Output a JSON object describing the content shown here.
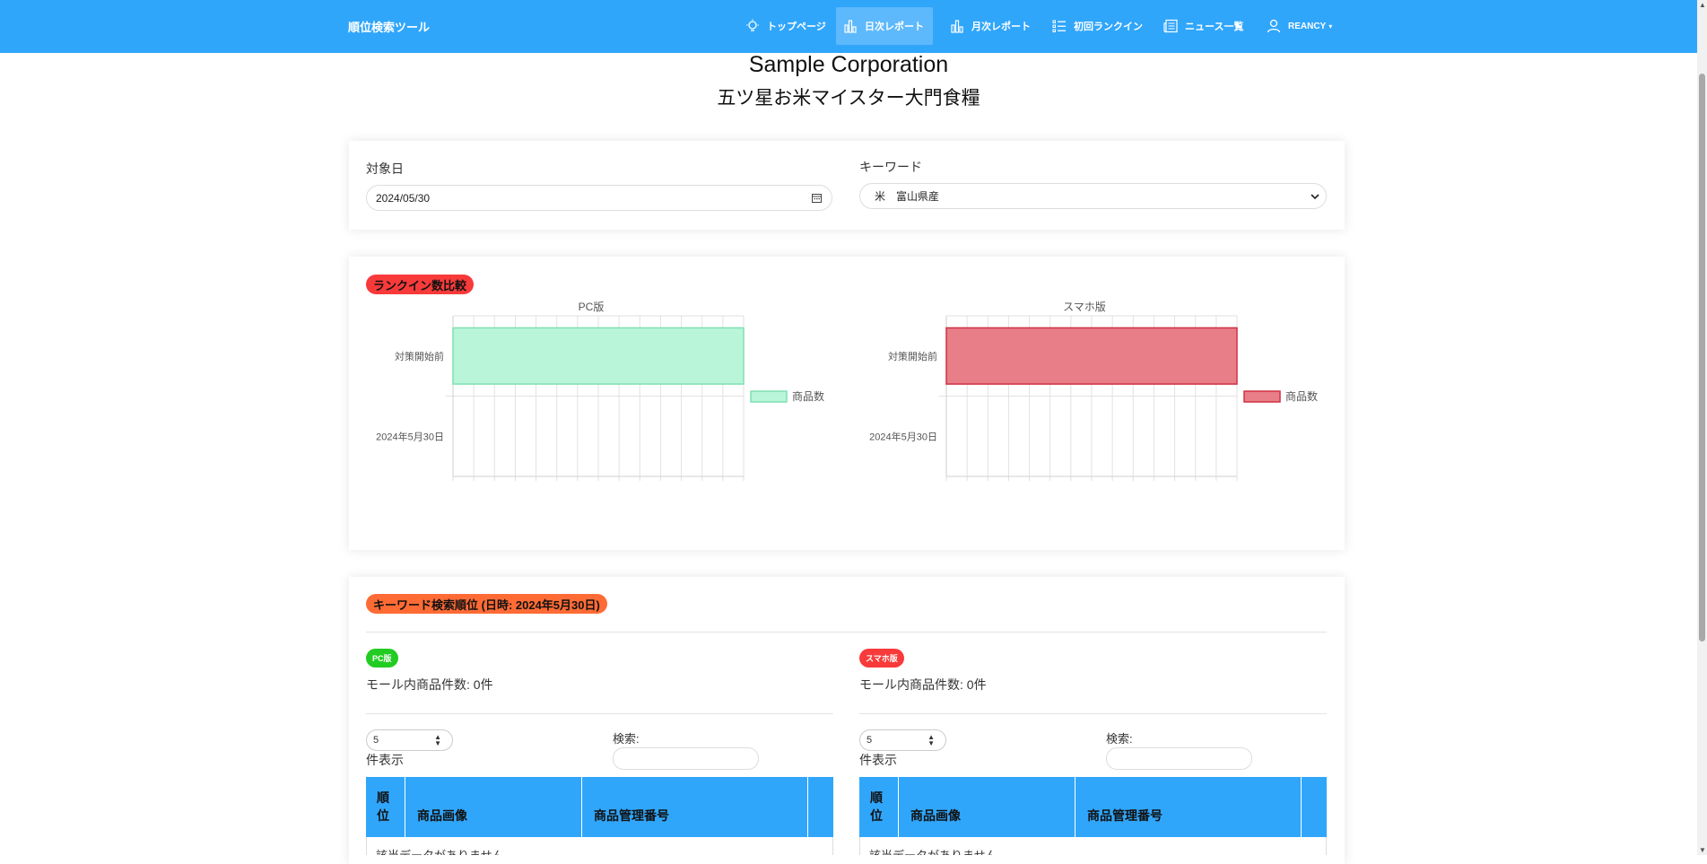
{
  "nav": {
    "brand": "順位検索ツール",
    "items": [
      {
        "label": "トップページ",
        "icon": "lightbulb-icon"
      },
      {
        "label": "日次レポート",
        "icon": "bar-chart-icon"
      },
      {
        "label": "月次レポート",
        "icon": "bar-chart-icon"
      },
      {
        "label": "初回ランクイン",
        "icon": "list-icon"
      },
      {
        "label": "ニュース一覧",
        "icon": "newspaper-icon"
      },
      {
        "label": "REANCY",
        "icon": "user-icon"
      }
    ],
    "user_caret": "▾",
    "color": "#30a6fb"
  },
  "header": {
    "company": "Sample Corporation",
    "shop": "五ツ星お米マイスター大門食糧"
  },
  "filters": {
    "date_label": "対象日",
    "date_value": "2024/05/30",
    "keyword_label": "キーワード",
    "keyword_value": "米　富山県産"
  },
  "rankin": {
    "badge": "ランクイン数比較",
    "badge_color": "#f83a3a"
  },
  "chart_data": [
    {
      "type": "bar",
      "orientation": "horizontal",
      "title": "PC版",
      "categories": [
        "対策開始前",
        "2024年5月30日"
      ],
      "series": [
        {
          "name": "商品数",
          "values": [
            42,
            0
          ],
          "color": "#b8f5d9",
          "border": "#7fe0b2"
        }
      ],
      "xlim": [
        0,
        42
      ],
      "xticks": [
        0,
        3,
        6,
        9,
        12,
        15,
        18,
        21,
        24,
        27,
        30,
        33,
        36,
        39,
        42
      ],
      "legend": "right"
    },
    {
      "type": "bar",
      "orientation": "horizontal",
      "title": "スマホ版",
      "categories": [
        "対策開始前",
        "2024年5月30日"
      ],
      "series": [
        {
          "name": "商品数",
          "values": [
            42,
            0
          ],
          "color": "#e87f88",
          "border": "#d13043"
        }
      ],
      "xlim": [
        0,
        42
      ],
      "xticks": [
        0,
        3,
        6,
        9,
        12,
        15,
        18,
        21,
        24,
        27,
        30,
        33,
        36,
        39,
        42
      ],
      "legend": "right"
    }
  ],
  "ranking": {
    "badge": "キーワード検索順位 (日時: 2024年5月30日)",
    "badge_color": "#ff6b35",
    "pc": {
      "badge": "PC版",
      "badge_color": "#22cc22",
      "count_text": "モール内商品件数: 0件",
      "length_value": "5",
      "length_label": "件表示",
      "search_label": "検索:",
      "columns": [
        "順位",
        "商品画像",
        "商品管理番号",
        ""
      ],
      "empty_text": "該当データがありません"
    },
    "sp": {
      "badge": "スマホ版",
      "badge_color": "#f83a3a",
      "count_text": "モール内商品件数: 0件",
      "length_value": "5",
      "length_label": "件表示",
      "search_label": "検索:",
      "columns": [
        "順位",
        "商品画像",
        "商品管理番号",
        ""
      ],
      "empty_text": "該当データがありません"
    }
  }
}
